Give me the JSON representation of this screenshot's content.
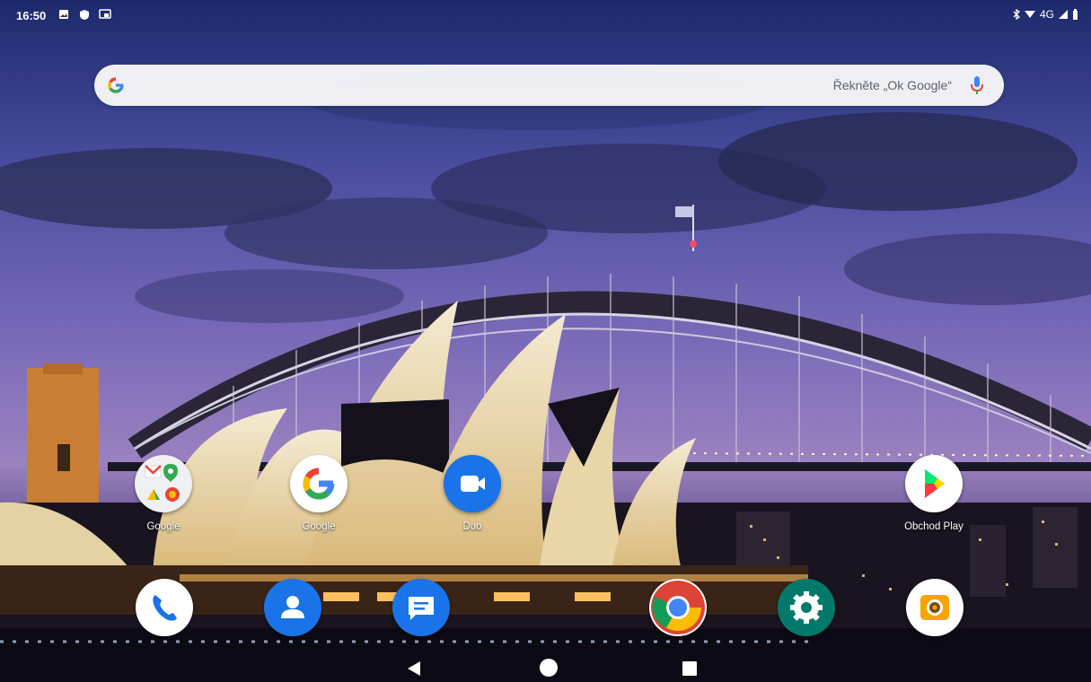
{
  "status_bar": {
    "time": "16:50",
    "network": "4G",
    "left_icons": [
      "image-icon",
      "shield-icon",
      "cast-icon"
    ],
    "right_icons": [
      "bluetooth-icon",
      "wifi-icon",
      "signal-icon",
      "battery-icon"
    ]
  },
  "search_bar": {
    "hint": "Řekněte „Ok Google“",
    "icons": [
      "google-g-icon",
      "mic-icon"
    ]
  },
  "home_apps": [
    {
      "label": "Google",
      "icon": "google-folder-icon"
    },
    {
      "label": "Google",
      "icon": "google-app-icon"
    },
    {
      "label": "Duo",
      "icon": "duo-icon"
    },
    {
      "label": "Obchod Play",
      "icon": "play-store-icon"
    }
  ],
  "dock_apps": [
    {
      "icon": "phone-icon",
      "color": "#ffffff"
    },
    {
      "icon": "contacts-icon",
      "color": "#1a73e8"
    },
    {
      "icon": "messages-icon",
      "color": "#1a73e8"
    },
    {
      "icon": "chrome-icon",
      "color": "#ffffff"
    },
    {
      "icon": "settings-icon",
      "color": "#00796b"
    },
    {
      "icon": "camera-icon",
      "color": "#ffffff"
    }
  ],
  "nav_bar": {
    "icons": [
      "back-icon",
      "home-icon",
      "recents-icon"
    ]
  }
}
